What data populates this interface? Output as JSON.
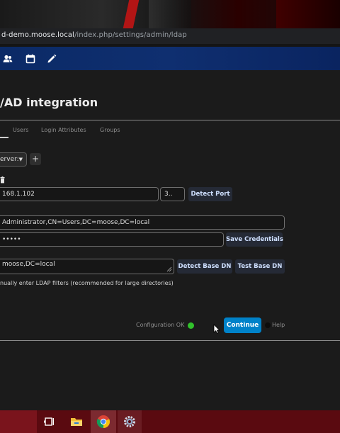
{
  "browser": {
    "url_host": "d-demo.moose.local",
    "url_path": "/index.php/settings/admin/ldap"
  },
  "header": {
    "icons": [
      "contacts-icon",
      "calendar-icon",
      "pencil-icon"
    ]
  },
  "page": {
    "title": "/AD integration",
    "tabs": [
      {
        "label": "Users"
      },
      {
        "label": "Login Attributes"
      },
      {
        "label": "Groups"
      }
    ]
  },
  "server": {
    "select_value": "erver:",
    "add_label": "+"
  },
  "fields": {
    "host": "168.1.102",
    "port": "3..",
    "user_dn": "Administrator,CN=Users,DC=moose,DC=local",
    "password": "•••••",
    "base_dn": "moose,DC=local"
  },
  "buttons": {
    "detect_port": "Detect Port",
    "save_credentials": "Save Credentials",
    "detect_base_dn": "Detect Base DN",
    "test_base_dn": "Test Base DN",
    "continue": "Continue"
  },
  "checkbox": {
    "label": "nually enter LDAP filters (recommended for large directories)"
  },
  "status": {
    "configuration": "Configuration OK",
    "help": "Help",
    "ok_color": "#31c12b"
  },
  "colors": {
    "header": "#0f2f70",
    "accent": "#0082c9",
    "taskbar": "#5a0a10"
  },
  "taskbar": {
    "icons": [
      "task-view-icon",
      "file-explorer-icon",
      "chrome-icon",
      "settings-icon"
    ]
  }
}
